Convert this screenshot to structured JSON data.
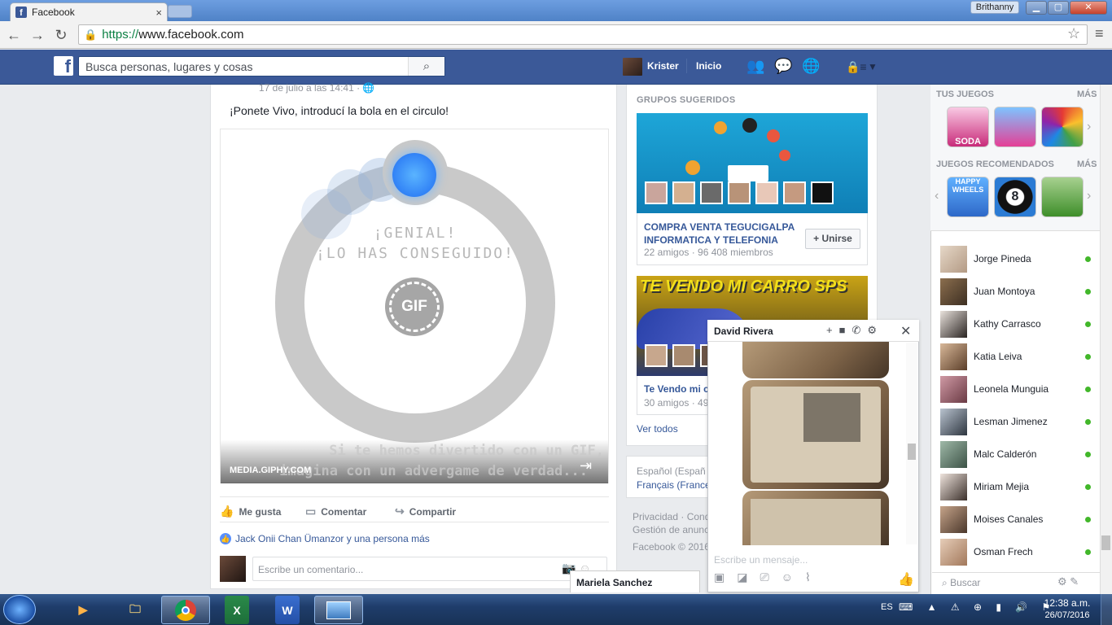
{
  "browser": {
    "tab_title": "Facebook",
    "tab_close": "×",
    "window_user": "Brithanny",
    "url_https": "https://",
    "url_host": "www.facebook.com"
  },
  "fb_header": {
    "logo": "f",
    "search_placeholder": "Busca personas, lugares y cosas",
    "profile_name": "Krister",
    "home": "Inicio"
  },
  "post": {
    "date": "17 de julio a las 14:41 · ",
    "text": "¡Ponete Vivo, introducí la bola en el circulo!",
    "game_line1": "¡GENIAL!",
    "game_line2": "¡LO HAS CONSEGUIDO!",
    "gif_badge": "GIF",
    "caption_line1": "Si te hemos divertido con un GIF,",
    "caption_line2": "imagina con un advergame de verdad...",
    "source": "MEDIA.GIPHY.COM",
    "actions": [
      "Me gusta",
      "Comentar",
      "Compartir"
    ],
    "likes": "Jack Onii Chan Ümanzor y una persona más",
    "comment_placeholder": "Escribe un comentario..."
  },
  "suggested_groups": {
    "heading": "GRUPOS SUGERIDOS",
    "groups": [
      {
        "name": "COMPRA VENTA TEGUCIGALPA INFORMATICA Y TELEFONIA",
        "meta": "22 amigos · 96 408 miembros",
        "join": "+ Unirse"
      },
      {
        "name": "Te Vendo mi c",
        "meta": "30 amigos · 49",
        "banner": "TE VENDO MI CARRO SPS"
      }
    ],
    "see_all": "Ver todos"
  },
  "languages": {
    "line1": "Español (Españ",
    "line2": "Français (France"
  },
  "footer": {
    "line1": "Privacidad · Cond",
    "line2": "Gestión de anunc",
    "line3": "Facebook © 2016"
  },
  "sidebar": {
    "games_heading": "TUS JUEGOS",
    "more": "MÁS",
    "recommended_heading": "JUEGOS RECOMENDADOS",
    "game_soda": "SODA",
    "game_wheel": "HAPPY WHEELS",
    "game_pool": "8",
    "contacts": [
      {
        "name": "Jorge Pineda"
      },
      {
        "name": "Juan Montoya"
      },
      {
        "name": "Kathy Carrasco"
      },
      {
        "name": "Katia Leiva"
      },
      {
        "name": "Leonela Munguia"
      },
      {
        "name": "Lesman Jimenez"
      },
      {
        "name": "Malc Calderón"
      },
      {
        "name": "Miriam Mejia"
      },
      {
        "name": "Moises Canales"
      },
      {
        "name": "Osman Frech"
      }
    ],
    "search_placeholder": "Buscar"
  },
  "chat": {
    "name": "David Rivera",
    "input_placeholder": "Escribe un mensaje...",
    "minimized_tab": "Mariela Sanchez"
  },
  "taskbar": {
    "language": "ES",
    "time": "12:38 a.m.",
    "date": "26/07/2016"
  },
  "colors": {
    "fb_blue": "#3b5998",
    "link": "#365899",
    "online": "#42b72a"
  }
}
